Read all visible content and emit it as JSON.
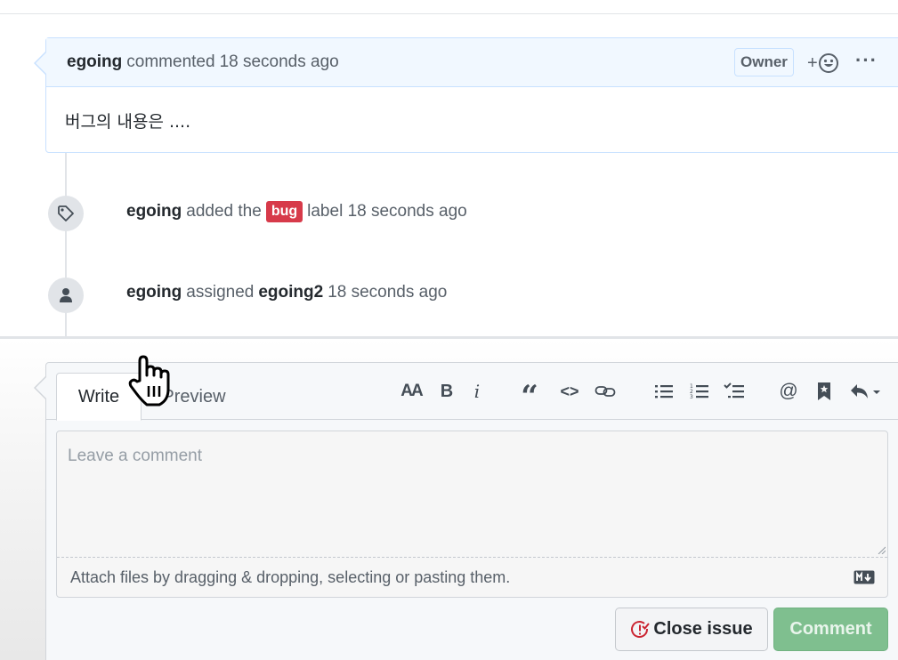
{
  "comment": {
    "author": "egoing",
    "action": "commented",
    "time": "18 seconds ago",
    "badge": "Owner",
    "reaction_label": "+",
    "more_label": "···",
    "body": "버그의 내용은 ...."
  },
  "timeline": [
    {
      "icon": "tag-icon",
      "actor": "egoing",
      "pre": "added the",
      "label": "bug",
      "post": "label 18 seconds ago"
    },
    {
      "icon": "person-icon",
      "actor": "egoing",
      "pre": "assigned",
      "target": "egoing2",
      "post": "18 seconds ago"
    }
  ],
  "editor": {
    "tabs": [
      "Write",
      "Preview"
    ],
    "active_tab": "Write",
    "toolbar": {
      "heading": "AA",
      "bold": "B",
      "italic": "i",
      "quote": "“",
      "code": "<>",
      "link": "link-icon",
      "unordered_list": "unordered-list-icon",
      "ordered_list": "ordered-list-icon",
      "task_list": "task-list-icon",
      "mention": "@",
      "saved_reply": "bookmark-icon",
      "reply": "reply-icon"
    },
    "placeholder": "Leave a comment",
    "attach_text": "Attach files by dragging & dropping, selecting or pasting them."
  },
  "buttons": {
    "close_issue": "Close issue",
    "comment": "Comment"
  },
  "colors": {
    "bug_label": "#d73a4a",
    "comment_header": "#f1f8ff",
    "comment_button": "#7fbf8f"
  }
}
